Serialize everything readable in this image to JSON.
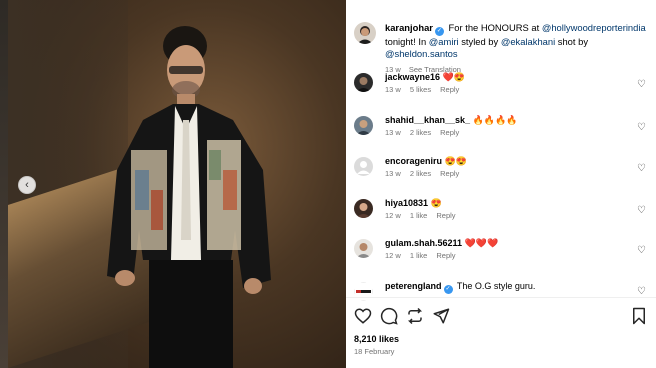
{
  "post": {
    "author": "karanjohar",
    "caption_pre": "For the HONOURS at ",
    "caption_tag1": "@hollywoodreporterindia",
    "caption_mid1": " tonight! In ",
    "caption_tag2": "@amiri",
    "caption_mid2": " styled by ",
    "caption_tag3": "@ekalakhani",
    "caption_mid3": " shot by ",
    "caption_tag4": "@sheldon.santos",
    "age": "13 w",
    "see_translation": "See Translation"
  },
  "comments": [
    {
      "user": "jackwayne16",
      "text": "❤️😍",
      "age": "13 w",
      "likes": "5 likes",
      "reply": "Reply"
    },
    {
      "user": "shahid__khan__sk_",
      "text": "🔥🔥🔥🔥",
      "age": "13 w",
      "likes": "2 likes",
      "reply": "Reply"
    },
    {
      "user": "encorageniru",
      "text": "😍😍",
      "age": "13 w",
      "likes": "2 likes",
      "reply": "Reply"
    },
    {
      "user": "hiya10831",
      "text": "😍",
      "age": "12 w",
      "likes": "1 like",
      "reply": "Reply"
    },
    {
      "user": "gulam.shah.56211",
      "text": "❤️❤️❤️",
      "age": "12 w",
      "likes": "1 like",
      "reply": "Reply"
    },
    {
      "user": "peterengland",
      "text": "The O.G style guru.",
      "verified": true
    }
  ],
  "footer": {
    "likes": "8,210 likes",
    "date": "18 February"
  },
  "icons": {
    "like": "heart-icon",
    "comment": "comment-icon",
    "share": "share-icon",
    "repost": "repost-icon",
    "save": "bookmark-icon",
    "carousel_prev": "chevron-left-icon"
  },
  "colors": {
    "link": "#00376b",
    "verified": "#3897f0",
    "muted": "#737373",
    "emoji_red": "#e0245e"
  }
}
